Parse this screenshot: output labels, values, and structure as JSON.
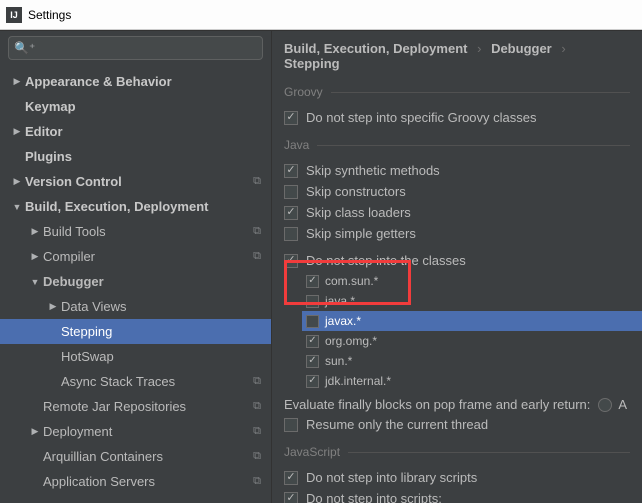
{
  "titlebar": {
    "title": "Settings"
  },
  "search": {
    "placeholder": ""
  },
  "sidebar": {
    "items": [
      {
        "label": "Appearance & Behavior",
        "arrow": "▶",
        "cls": "bold pad0"
      },
      {
        "label": "Keymap",
        "arrow": "",
        "cls": "bold pad0",
        "inset": true
      },
      {
        "label": "Editor",
        "arrow": "▶",
        "cls": "bold pad0"
      },
      {
        "label": "Plugins",
        "arrow": "",
        "cls": "bold pad0",
        "inset": true
      },
      {
        "label": "Version Control",
        "arrow": "▶",
        "cls": "bold pad0",
        "copy": true
      },
      {
        "label": "Build, Execution, Deployment",
        "arrow": "▼",
        "cls": "bold pad0"
      },
      {
        "label": "Build Tools",
        "arrow": "▶",
        "cls": "pad1",
        "copy": true
      },
      {
        "label": "Compiler",
        "arrow": "▶",
        "cls": "pad1",
        "copy": true
      },
      {
        "label": "Debugger",
        "arrow": "▼",
        "cls": "pad1 current"
      },
      {
        "label": "Data Views",
        "arrow": "▶",
        "cls": "pad2"
      },
      {
        "label": "Stepping",
        "arrow": "",
        "cls": "pad2 selected",
        "inset": true
      },
      {
        "label": "HotSwap",
        "arrow": "",
        "cls": "pad2",
        "inset": true
      },
      {
        "label": "Async Stack Traces",
        "arrow": "",
        "cls": "pad2",
        "copy": true,
        "inset": true
      },
      {
        "label": "Remote Jar Repositories",
        "arrow": "",
        "cls": "pad1",
        "copy": true,
        "inset": true
      },
      {
        "label": "Deployment",
        "arrow": "▶",
        "cls": "pad1",
        "copy": true
      },
      {
        "label": "Arquillian Containers",
        "arrow": "",
        "cls": "pad1",
        "copy": true,
        "inset": true
      },
      {
        "label": "Application Servers",
        "arrow": "",
        "cls": "pad1",
        "copy": true,
        "inset": true
      }
    ]
  },
  "breadcrumb": {
    "a": "Build, Execution, Deployment",
    "b": "Debugger",
    "c": "Stepping"
  },
  "groovy": {
    "title": "Groovy",
    "opt0": {
      "label": "Do not step into specific Groovy classes",
      "checked": true
    }
  },
  "java": {
    "title": "Java",
    "opts": [
      {
        "label": "Skip synthetic methods",
        "checked": true
      },
      {
        "label": "Skip constructors",
        "checked": false
      },
      {
        "label": "Skip class loaders",
        "checked": true
      },
      {
        "label": "Skip simple getters",
        "checked": false
      }
    ],
    "dnsi": {
      "label": "Do not step into the classes",
      "checked": true
    },
    "classes": [
      {
        "label": "com.sun.*",
        "checked": true
      },
      {
        "label": "java.*",
        "checked": false
      },
      {
        "label": "javax.*",
        "checked": false,
        "sel": true
      },
      {
        "label": "org.omg.*",
        "checked": true
      },
      {
        "label": "sun.*",
        "checked": true
      },
      {
        "label": "jdk.internal.*",
        "checked": true
      }
    ],
    "eval": "Evaluate finally blocks on pop frame and early return:",
    "evalradio": "A",
    "resume": {
      "label": "Resume only the current thread",
      "checked": false
    }
  },
  "js": {
    "title": "JavaScript",
    "opt0": {
      "label": "Do not step into library scripts",
      "checked": true
    },
    "opt1": {
      "label": "Do not step into scripts:",
      "checked": true
    }
  }
}
